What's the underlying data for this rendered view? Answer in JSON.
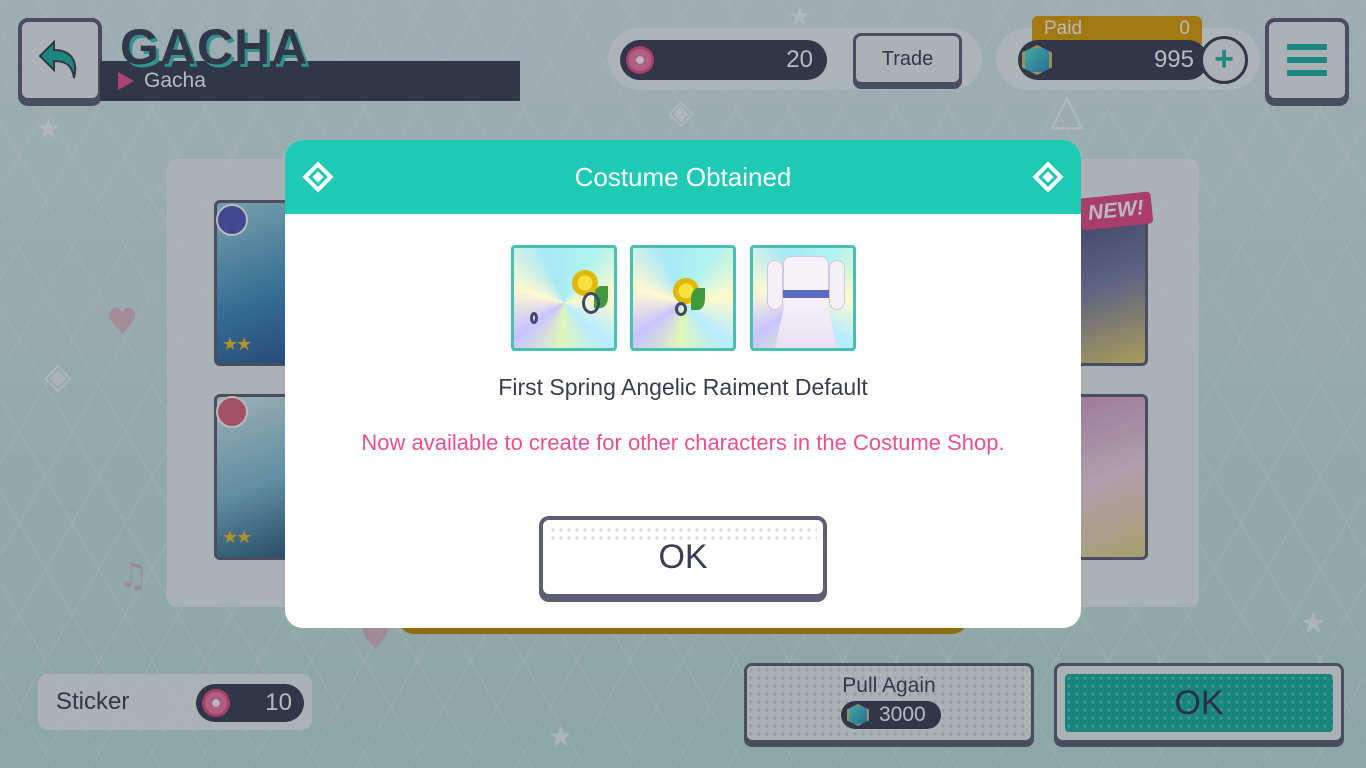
{
  "header": {
    "title": "GACHA",
    "breadcrumb": "Gacha"
  },
  "currency": {
    "music_cd_count": "20",
    "trade_label": "Trade",
    "paid_label": "Paid",
    "paid_value": "0",
    "gem_count": "995",
    "add_label": "+"
  },
  "cards": {
    "new_badge": "NEW!",
    "rarity_stars": [
      "★★",
      "★★"
    ]
  },
  "bottom": {
    "sticker_label": "Sticker",
    "sticker_count": "10",
    "pull_again_label": "Pull Again",
    "pull_cost": "3000",
    "ok_label": "OK"
  },
  "modal": {
    "title": "Costume Obtained",
    "item_name": "First Spring Angelic Raiment Default",
    "notice": "Now available to create for other characters in the Costume Shop.",
    "ok_label": "OK"
  },
  "colors": {
    "accent_teal": "#1fcab5",
    "notice_pink": "#ef4f8c",
    "navy": "#3a3d52",
    "gold": "#e0a000"
  }
}
